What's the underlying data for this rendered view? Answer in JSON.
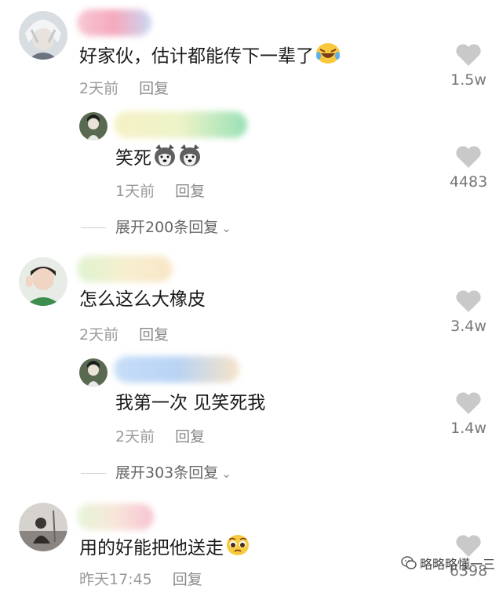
{
  "comments": [
    {
      "text": "好家伙，估计都能传下一辈了",
      "time": "2天前",
      "reply": "回复",
      "likes": "1.5w",
      "sub": {
        "text": "笑死",
        "time": "1天前",
        "reply": "回复",
        "likes": "4483"
      },
      "expand": "展开200条回复"
    },
    {
      "text": "怎么这么大橡皮",
      "time": "2天前",
      "reply": "回复",
      "likes": "3.4w",
      "sub": {
        "text": "我第一次 见笑死我",
        "time": "2天前",
        "reply": "回复",
        "likes": "1.4w"
      },
      "expand": "展开303条回复"
    },
    {
      "text": "用的好能把他送走",
      "time": "昨天17:45",
      "reply": "回复",
      "likes": "6398"
    }
  ],
  "watermark": "略略略懂一三",
  "icons": {
    "like": "heart-icon",
    "expand": "chevron-down-icon",
    "watermark": "wechat-icon"
  },
  "colors": {
    "background": "#ffffff",
    "meta": "#9a9a9a",
    "heart": "#c9c9c9"
  }
}
